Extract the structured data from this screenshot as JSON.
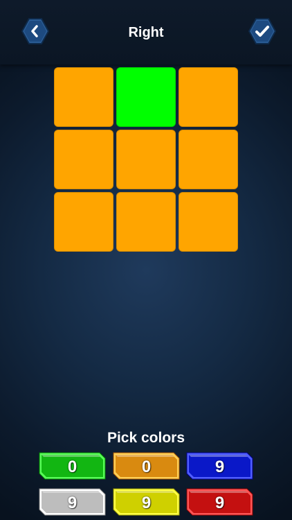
{
  "header": {
    "title": "Right",
    "back_icon": "chevron-left-icon",
    "confirm_icon": "checkmark-icon"
  },
  "cube_face": {
    "rows": 3,
    "cols": 3,
    "cells": [
      "#FFA500",
      "#00FF00",
      "#FFA500",
      "#FFA500",
      "#FFA500",
      "#FFA500",
      "#FFA500",
      "#FFA500",
      "#FFA500"
    ]
  },
  "palette": {
    "title": "Pick colors",
    "colors": [
      {
        "name": "green",
        "color": "#12B612",
        "count": "0"
      },
      {
        "name": "orange",
        "color": "#D98A10",
        "count": "0"
      },
      {
        "name": "blue",
        "color": "#0A18C8",
        "count": "9"
      },
      {
        "name": "white",
        "color": "#BDBDBD",
        "count": "9"
      },
      {
        "name": "yellow",
        "color": "#CFD000",
        "count": "9"
      },
      {
        "name": "red",
        "color": "#C41010",
        "count": "9"
      }
    ]
  }
}
